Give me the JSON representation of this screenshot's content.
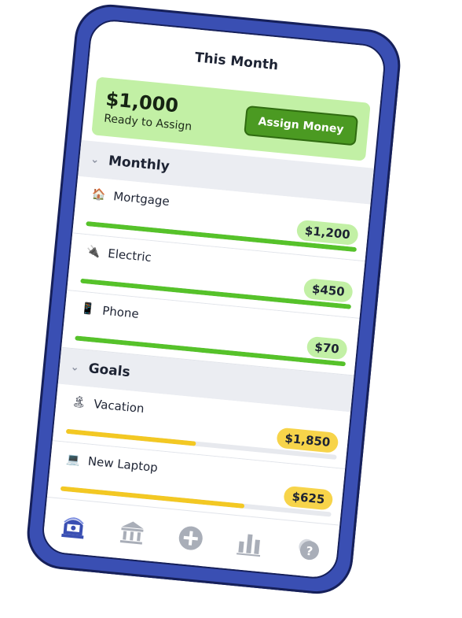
{
  "header": {
    "title": "This Month"
  },
  "assign": {
    "amount": "$1,000",
    "label": "Ready to Assign",
    "button_label": "Assign Money"
  },
  "groups": [
    {
      "name": "Monthly",
      "categories": [
        {
          "icon": "🏠",
          "icon_name": "house-icon",
          "name": "Mortgage",
          "amount": "$1,200",
          "progress": 1.0,
          "color": "green"
        },
        {
          "icon": "🔌",
          "icon_name": "plug-icon",
          "name": "Electric",
          "amount": "$450",
          "progress": 1.0,
          "color": "green"
        },
        {
          "icon": "📱",
          "icon_name": "phone-icon",
          "name": "Phone",
          "amount": "$70",
          "progress": 1.0,
          "color": "green"
        }
      ]
    },
    {
      "name": "Goals",
      "categories": [
        {
          "icon": "🏝",
          "icon_name": "island-icon",
          "name": "Vacation",
          "amount": "$1,850",
          "progress": 0.48,
          "color": "yellow"
        },
        {
          "icon": "💻",
          "icon_name": "laptop-icon",
          "name": "New Laptop",
          "amount": "$625",
          "progress": 0.68,
          "color": "yellow"
        }
      ]
    }
  ],
  "tabs": [
    {
      "icon_name": "budget-icon",
      "active": true
    },
    {
      "icon_name": "accounts-icon",
      "active": false
    },
    {
      "icon_name": "add-transaction-icon",
      "active": false
    },
    {
      "icon_name": "reports-icon",
      "active": false
    },
    {
      "icon_name": "help-icon",
      "active": false
    }
  ],
  "colors": {
    "accent_blue": "#3a4fb3",
    "progress_green": "#56c22a",
    "progress_yellow": "#f3c823",
    "assign_bg": "#c2f0a5",
    "assign_button": "#4b9a22"
  }
}
